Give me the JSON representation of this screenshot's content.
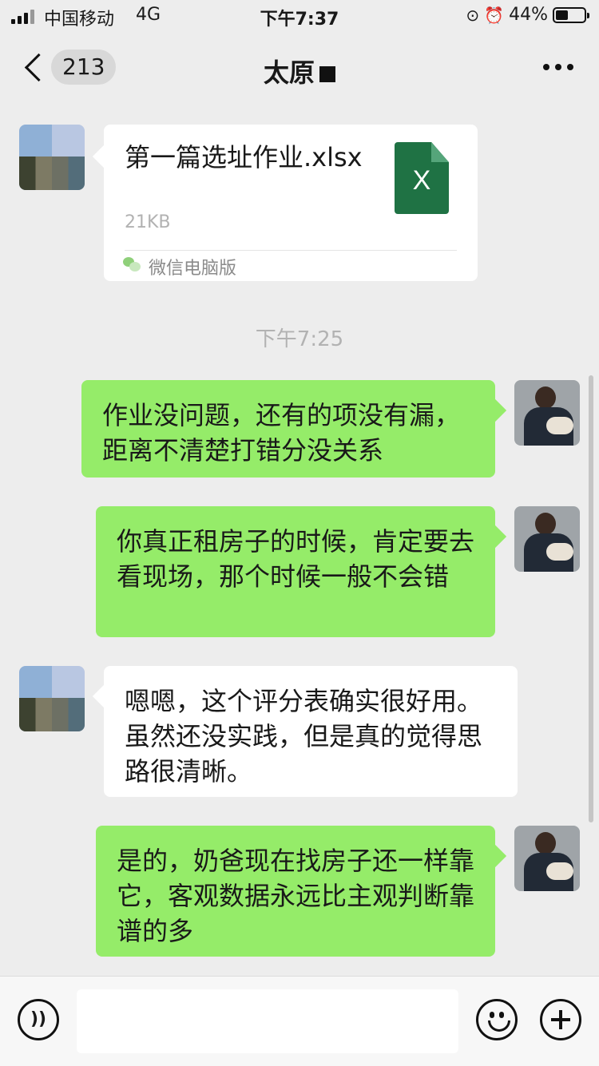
{
  "status_bar": {
    "carrier": "中国移动",
    "network": "4G",
    "time": "下午7:37",
    "icons": [
      "rotation-lock-icon",
      "alarm-icon"
    ],
    "battery_percent": "44%",
    "battery_level": 0.44
  },
  "nav": {
    "unread_count": "213",
    "title": "太原",
    "back_icon": "chevron-left-icon",
    "more_icon": "more-icon"
  },
  "file_message": {
    "file_name": "第一篇选址作业.xlsx",
    "file_size": "21KB",
    "file_icon": "excel-file-icon",
    "file_icon_letter": "X",
    "file_icon_color": "#1f7244",
    "source": "微信电脑版"
  },
  "timestamp": "下午7:25",
  "messages": [
    {
      "sender": "self",
      "text": "作业没问题，还有的项没有漏，距离不清楚打错分没关系"
    },
    {
      "sender": "self",
      "text": "你真正租房子的时候，肯定要去看现场，那个时候一般不会错"
    },
    {
      "sender": "contact",
      "text": "嗯嗯，这个评分表确实很好用。虽然还没实践，但是真的觉得思路很清晰。"
    },
    {
      "sender": "self",
      "text": "是的，奶爸现在找房子还一样靠它，客观数据永远比主观判断靠谱的多"
    }
  ],
  "input_bar": {
    "voice_icon": "voice-icon",
    "emoji_icon": "emoji-icon",
    "add_icon": "plus-icon",
    "text": ""
  },
  "colors": {
    "background": "#ededed",
    "self_bubble": "#95ec69",
    "other_bubble": "#ffffff"
  }
}
